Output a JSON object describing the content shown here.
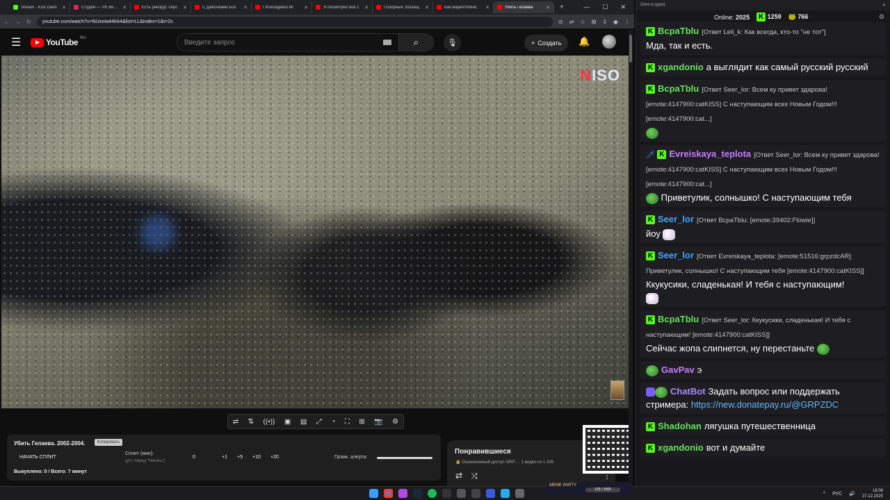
{
  "browser": {
    "tabs": [
      {
        "title": "Stream - Kick Dash",
        "color": "#53fc18"
      },
      {
        "title": "Студия — VK Видео",
        "color": "#e0245e"
      },
      {
        "title": "Есть рекорд! Перс",
        "color": "#ff0000"
      },
      {
        "title": "С Девочками Бол",
        "color": "#ff0000"
      },
      {
        "title": "I Investigated Mi",
        "color": "#ff0000"
      },
      {
        "title": "Я посмотрел все с",
        "color": "#ff0000"
      },
      {
        "title": "Позорные Зоозащ",
        "color": "#ff0000"
      },
      {
        "title": "Как маркетплейс",
        "color": "#ff0000"
      },
      {
        "title": "Убить Гелаева",
        "color": "#ff0000",
        "active": true
      }
    ],
    "url": "youtube.com/watch?v=NUeota44Kk4&list=LL&index=1&t=2s"
  },
  "youtube": {
    "logo": "YouTube",
    "region": "RU",
    "search_placeholder": "Введите запрос",
    "create_label": "Создать"
  },
  "video": {
    "watermark_n": "N",
    "watermark_rest": "ISO"
  },
  "split": {
    "title": "Убить Гелаева. 2002-2004.",
    "copy_label": "Копировать",
    "start_label": "НАЧАТЬ СПЛИТ",
    "split_label": "Сплит (мин):",
    "split_hint": "(уст. перед \"Начать\")",
    "zero": "0",
    "inc1": "+1",
    "inc5": "+5",
    "inc10": "+10",
    "inc20": "+20",
    "volume_label": "Громк. алерта:",
    "bought": "Выкуплено: 0 / Всего: ? минут"
  },
  "liked": {
    "title": "Понравившиеся",
    "info": "🔒 Ограниченный доступ GRP... · 1 видео из 1 226"
  },
  "chat": {
    "window_title": "Окно в дурку",
    "online_label": "Online:",
    "online_count": "2025",
    "kick_count": "1259",
    "other_count": "766",
    "messages": [
      {
        "name": "BcpaTblu",
        "reply": "[Ответ Leli_k: Как всегда, кто-то \"не тот\"]",
        "text": "Мда, так и есть."
      },
      {
        "name": "xgandonio",
        "text": "а выглядит как самый русский русский"
      },
      {
        "name": "BcpaTblu",
        "reply": "[Ответ Seer_lor: Всем ку привет здарова! [emote:4147900:catKISS] С наступающим всех Новым Годом!!! [emote:4147900:cat...]"
      },
      {
        "name": "Evreiskaya_teplota",
        "reply": "[Ответ Seer_lor: Всем ку привет здарова! [emote:4147900:catKISS] С наступающим всех Новым Годом!!! [emote:4147900:cat...]",
        "text": "Приветулик, солнышко! С наступающим тебя"
      },
      {
        "name": "Seer_lor",
        "reply": "[Ответ BcpaTblu: [emote:39402:Flowie]]",
        "text": "йоу"
      },
      {
        "name": "Seer_lor",
        "reply": "[Ответ Evreiskaya_teplota: [emote:51516:grpzdcAR] Приветулик, солнышко! С наступающим тебя [emote:4147900:catKISS]]",
        "text": "Ккукусики, сладенькая! И тебя с наступающим!"
      },
      {
        "name": "BcpaTblu",
        "reply": "[Ответ Seer_lor: Ккукусики, сладенькая! И тебя с наступающим! [emote:4147900:catKISS]]",
        "text": "Сейчас жопа слипнется, ну перестаньте"
      },
      {
        "name": "GavPav",
        "text": "э"
      },
      {
        "name": "ChatBot",
        "text": "Задать вопрос или поддержать стримера:",
        "link": "https://new.donatepay.ru/@GRPZDC"
      },
      {
        "name": "Shadohan",
        "text": "лягушка путешественница"
      },
      {
        "name": "xgandonio",
        "text": "вот и думайте"
      }
    ]
  },
  "taskbar": {
    "party_label": "MEME PARTY",
    "party_progress": "125 / 1500",
    "lang": "РУС",
    "time": "18:06",
    "date": "27.12.2025"
  }
}
